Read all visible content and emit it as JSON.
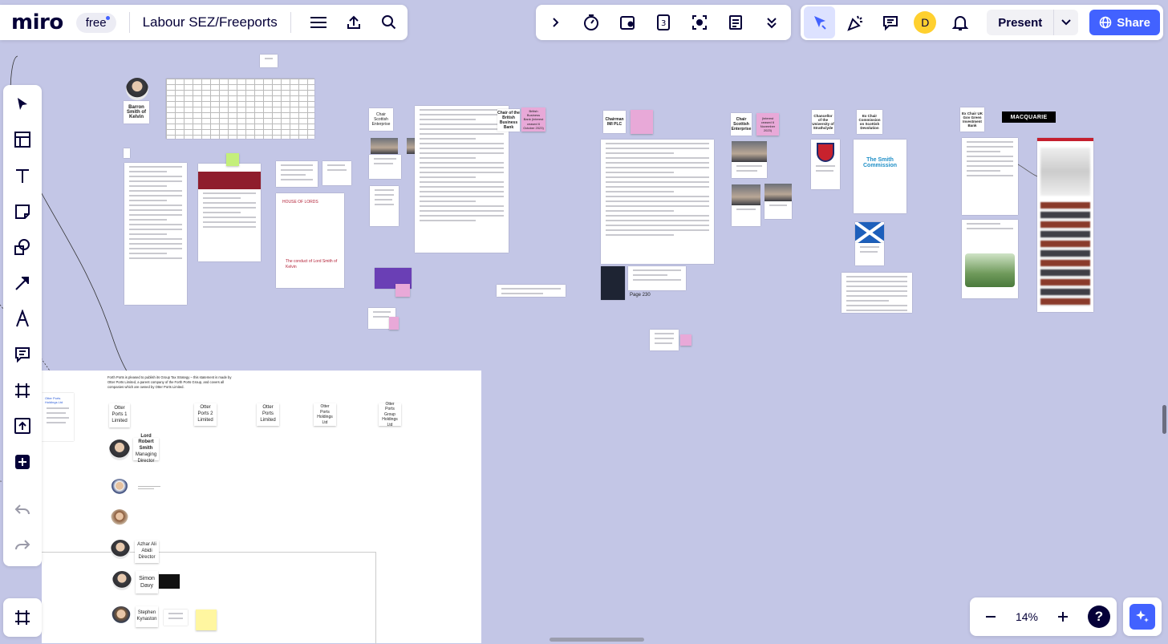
{
  "app": {
    "logo": "miro",
    "plan": "free",
    "board_title": "Labour SEZ/Freeports"
  },
  "top_right": {
    "avatar_initial": "D",
    "present_label": "Present",
    "share_label": "Share"
  },
  "zoom": {
    "level": "14%",
    "help": "?"
  },
  "colors": {
    "canvas": "#c3c6e6",
    "accent": "#4262ff",
    "avatar": "#ffd02f"
  },
  "board": {
    "people": [
      {
        "name": "Barron Smith of Kelvin"
      },
      {
        "name": "Lord Robert Smith",
        "role": "Managing Director"
      },
      {
        "name": "Azhar Ali Abidi",
        "role": "Director"
      },
      {
        "name": "Simon Davy"
      },
      {
        "name": "Stephen Kynaston"
      }
    ],
    "notes": {
      "chair_scottish_enterprise": "Chair Scottish Enterprise",
      "chair_british_business_bank": "Chair of the British Business Bank",
      "bbb_note": "British Business Bank (interest ceased 6 October 2023)",
      "chairman_imi": "Chairman IMI PLC",
      "chair_scottish_enterprise_2": "Chair Scottish Enterprise",
      "interest_ceased": "(interest ceased 6 November 2023)",
      "chancellor_strathclyde": "Chancellor of the University of Strathclyde",
      "ex_chair_commission": "Ex Chair Commission on Scottish Devolution",
      "ex_chair_uk_green_bank": "Ex Chair UK Gov Green Investment Bank",
      "macquarie": "MACQUARIE",
      "page_230": "Page 230",
      "house_of_lords": "HOUSE OF LORDS",
      "conduct_of": "The conduct of Lord Smith of Kelvin",
      "smith_commission": "The Smith Commission",
      "forth_ports_statement": "Forth Ports is pleased to publish its Group Tax Strategy – this statement is made by Otter Ports Limited, a parent company of the Forth Ports Group, and covers all companies which are owned by Otter Ports Limited."
    },
    "entities": [
      "Otter Ports 1 Limited",
      "Otter Ports 2 Limited",
      "Otter Ports Limited",
      "Otter Ports Holdings Ltd",
      "Otter Ports Group Holdings Ltd"
    ],
    "side_doc_title": "Otter Ports Holdings Ltd"
  }
}
